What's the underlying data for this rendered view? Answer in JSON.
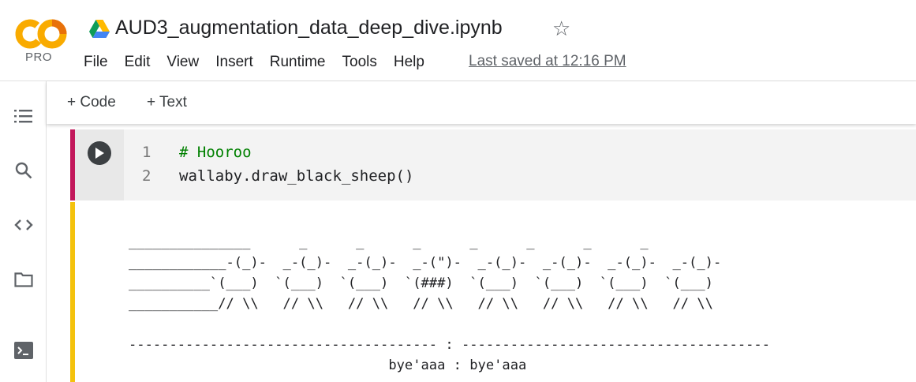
{
  "logo": {
    "badge": "PRO",
    "brand_colors": [
      "#f9ab00",
      "#e8710a"
    ]
  },
  "notebook": {
    "title": "AUD3_augmentation_data_deep_dive.ipynb"
  },
  "menu": [
    "File",
    "Edit",
    "View",
    "Insert",
    "Runtime",
    "Tools",
    "Help"
  ],
  "last_saved": "Last saved at 12:16 PM",
  "sidebar_icons": [
    "table-of-contents-icon",
    "search-icon",
    "code-snippets-icon",
    "files-folder-icon",
    "terminal-icon"
  ],
  "toolbar": {
    "code_label": "+ Code",
    "text_label": "+ Text"
  },
  "cell": {
    "line_numbers": [
      "1",
      "2"
    ],
    "lines": [
      "# Hooroo",
      "wallaby.draw_black_sheep()"
    ]
  },
  "output": {
    "text": "_______________      _      _      _      _      _      _      _\n____________-(_)-  _-(_)-  _-(_)-  _-(\")-  _-(_)-  _-(_)-  _-(_)-  _-(_)-\n__________`(___)  `(___)  `(___)  `(###)  `(___)  `(___)  `(___)  `(___)\n___________// \\\\   // \\\\   // \\\\   // \\\\   // \\\\   // \\\\   // \\\\   // \\\\\n\n-------------------------------------- : --------------------------------------\n                                bye'aaa : bye'aaa"
  }
}
